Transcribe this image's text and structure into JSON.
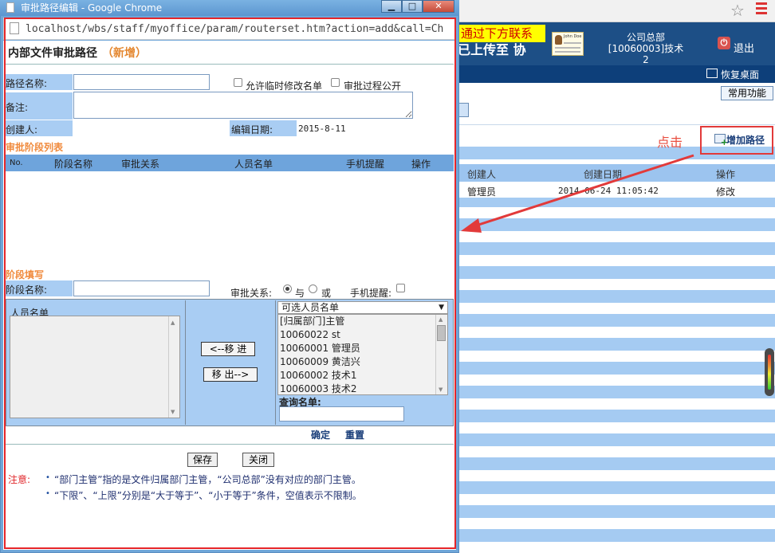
{
  "background_app": {
    "marquee_top": "通过下方联系",
    "marquee_bottom": "已上传至 协",
    "card_name": "John Doe",
    "org_name": "公司总部",
    "user_name": "[10060003]技术2",
    "exit_label": "退出",
    "restore_label": "恢复桌面",
    "common_button": "常用功能",
    "click_hint": "点击",
    "add_path_label": "增加路径",
    "table": {
      "headers": [
        "创建人",
        "创建日期",
        "操作"
      ],
      "rows": [
        {
          "creator": "管理员",
          "date": "2014-06-24 11:05:42",
          "action": "修改"
        }
      ]
    },
    "colors": {
      "header": "#1d4f86",
      "stripe": "#a5cbf2",
      "annotation_red": "#e23a3a"
    }
  },
  "popup": {
    "window_title": "审批路径编辑 - Google Chrome",
    "window_buttons": {
      "minimize": "▁",
      "maximize": "□",
      "close": "✕"
    },
    "url": "localhost/wbs/staff/myoffice/param/routerset.htm?action=add&call=Ch",
    "form_title": "内部文件审批路径",
    "form_title_suffix": "（新增）",
    "fields": {
      "path_name_label": "路径名称:",
      "path_name_value": "",
      "allow_temp_edit_label": "允许临时修改名单",
      "allow_temp_edit_checked": false,
      "public_process_label": "审批过程公开",
      "public_process_checked": false,
      "remark_label": "备注:",
      "remark_value": "",
      "creator_label": "创建人:",
      "creator_value": "",
      "edit_date_label": "编辑日期:",
      "edit_date_value": "2015-8-11"
    },
    "stage_list": {
      "title": "审批阶段列表",
      "headers": [
        "No.",
        "阶段名称",
        "审批关系",
        "人员名单",
        "手机提醒",
        "操作"
      ],
      "rows": []
    },
    "stage_fill": {
      "title": "阶段填写",
      "stage_name_label": "阶段名称:",
      "stage_name_value": "",
      "relation_label": "审批关系:",
      "relation_options": [
        "与",
        "或"
      ],
      "relation_selected": "与",
      "sms_label": "手机提醒:",
      "sms_checked": false
    },
    "picker": {
      "member_list_label": "人员名单",
      "move_in": "<--移 进",
      "move_out": "移 出-->",
      "available_select": "可选人员名单",
      "available_items": [
        "[归属部门]主管",
        "10060022 st",
        "10060001 管理员",
        "10060009 黄洁兴",
        "10060002 技术1",
        "10060003 技术2"
      ],
      "search_label": "查询名单:",
      "search_value": ""
    },
    "confirm_label": "确定",
    "reset_label": "重置",
    "save_label": "保存",
    "close_label": "关闭",
    "notes": {
      "heading": "注意:",
      "items": [
        "“部门主管”指的是文件归属部门主管，“公司总部”没有对应的部门主管。",
        "“下限”、“上限”分别是“大于等于”、“小于等于”条件，空值表示不限制。"
      ]
    },
    "colors": {
      "label_bg": "#a9cdf3",
      "section_title": "#f08a3c",
      "highlight_red": "#e5262a"
    }
  }
}
